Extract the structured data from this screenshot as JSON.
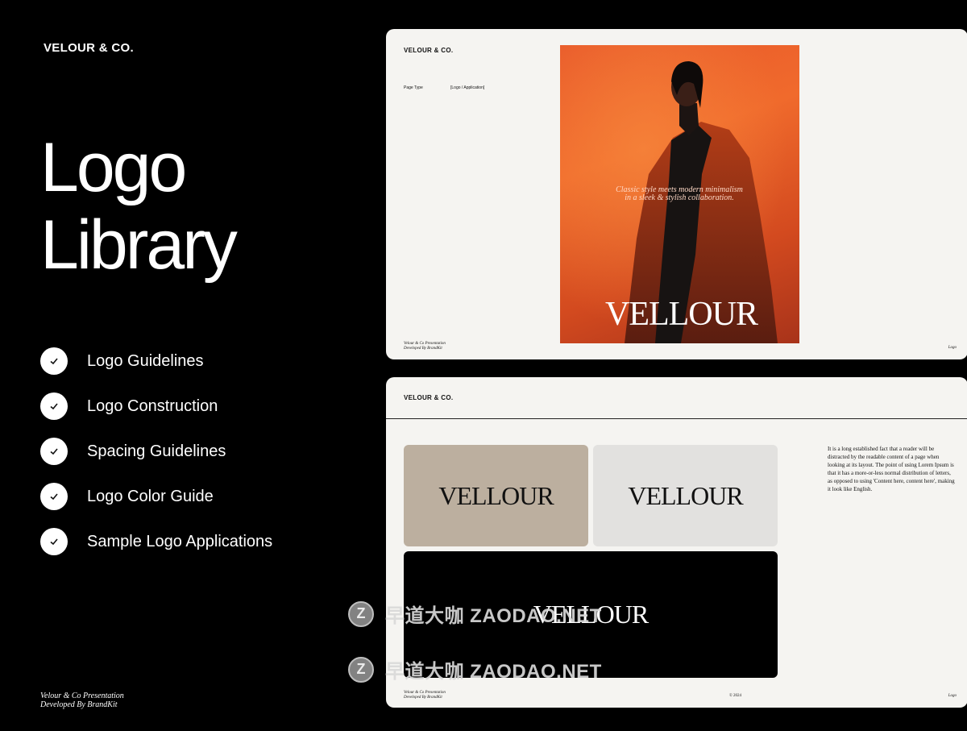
{
  "left_panel": {
    "brand": "VELOUR & CO.",
    "title_line1": "Logo",
    "title_line2": "Library",
    "features": [
      "Logo Guidelines",
      "Logo Construction",
      "Spacing Guidelines",
      "Logo Color Guide",
      "Sample Logo Applications"
    ],
    "credit_line1": "Velour & Co Presentation",
    "credit_line2": "Developed By BrandKit"
  },
  "card_top": {
    "brand": "VELOUR & CO.",
    "meta_key": "Page Type",
    "meta_value": "[Logo / Application]",
    "quote_line1": "Classic style meets modern minimalism",
    "quote_line2": "in a sleek & stylish collaboration.",
    "logo": "VELLOUR",
    "footer_line1": "Velour & Co Presentation",
    "footer_line2": "Developed By BrandKit",
    "page_label": "Logo"
  },
  "card_bottom": {
    "brand": "VELOUR & CO.",
    "logo": "VELLOUR",
    "body_text": "It is a long established fact that a reader will be distracted by the readable content of a page when looking at its layout. The point of using Lorem Ipsum is that it has a more-or-less normal distribution of letters, as opposed to using 'Content here, content here', making it look like English.",
    "footer_line1": "Velour & Co Presentation",
    "footer_line2": "Developed By BrandKit",
    "year": "© 2024",
    "page_label": "Logo",
    "tile_colors": [
      "#bcaf9f",
      "#e2e1df",
      "#000000"
    ]
  },
  "watermark": {
    "text": "早道大咖  ZAODAO.NET",
    "icon": "Z"
  }
}
